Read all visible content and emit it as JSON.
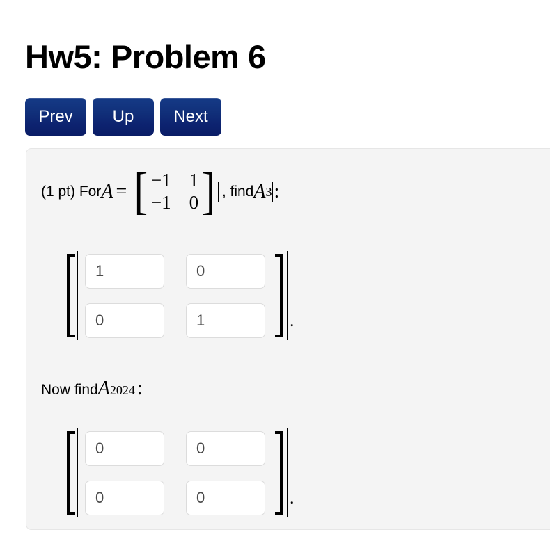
{
  "page": {
    "title": "Hw5: Problem 6",
    "background_color": "#ffffff"
  },
  "nav": {
    "buttons": [
      {
        "label": "Prev",
        "name": "prev-button"
      },
      {
        "label": "Up",
        "name": "up-button"
      },
      {
        "label": "Next",
        "name": "next-button"
      }
    ],
    "color": "#0d2370"
  },
  "problem": {
    "points_label": "(1 pt) For ",
    "variable": "A",
    "equals": "=",
    "matrix_A": {
      "rows": [
        [
          "−1",
          "1"
        ],
        [
          "−1",
          "0"
        ]
      ]
    },
    "find_prefix": ", find ",
    "find_variable": "A",
    "find_exponent": "3",
    "find_suffix": ":",
    "prompt_2_text": "Now find ",
    "prompt_2_variable": "A",
    "prompt_2_exponent": "2024",
    "prompt_2_suffix": ":",
    "panel_color": "#f4f4f4"
  },
  "answer_1": {
    "name": "answer-matrix-a-cubed",
    "cells": [
      {
        "name": "a3-r1c1",
        "value": "1",
        "placeholder": ""
      },
      {
        "name": "a3-r1c2",
        "value": "0",
        "placeholder": ""
      },
      {
        "name": "a3-r2c1",
        "value": "0",
        "placeholder": ""
      },
      {
        "name": "a3-r2c2",
        "value": "1",
        "placeholder": ""
      }
    ],
    "trailing": "."
  },
  "answer_2": {
    "name": "answer-matrix-a-2024",
    "cells": [
      {
        "name": "a2024-r1c1",
        "value": "0",
        "placeholder": ""
      },
      {
        "name": "a2024-r1c2",
        "value": "0",
        "placeholder": ""
      },
      {
        "name": "a2024-r2c1",
        "value": "0",
        "placeholder": ""
      },
      {
        "name": "a2024-r2c2",
        "value": "0",
        "placeholder": ""
      }
    ],
    "trailing": "."
  }
}
